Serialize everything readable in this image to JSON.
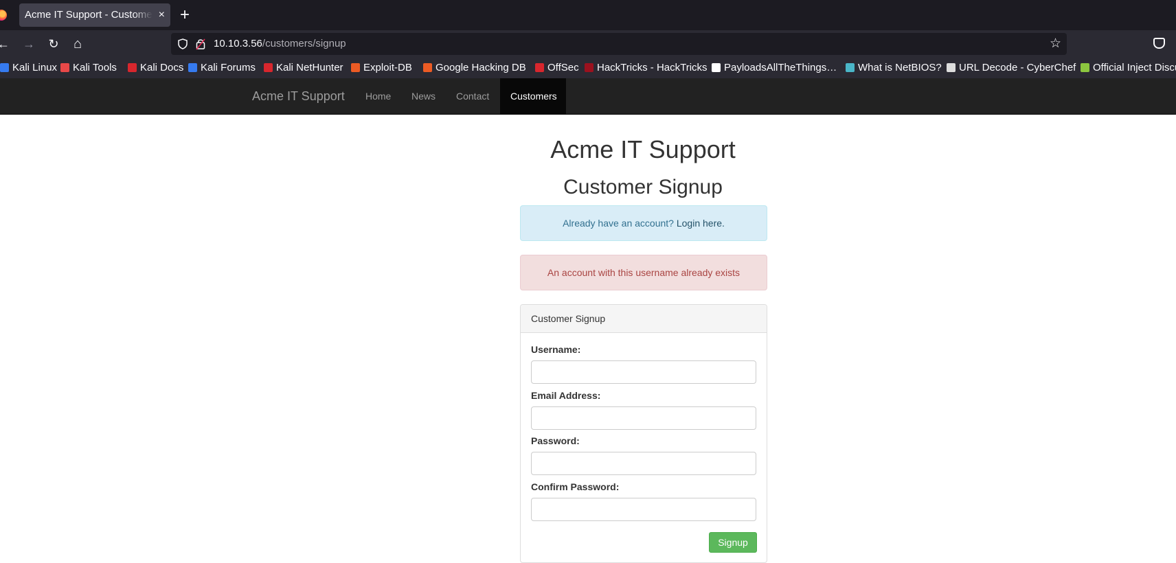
{
  "browser": {
    "tab_title": "Acme IT Support - Customers",
    "tab_close": "×",
    "new_tab": "+",
    "back": "←",
    "forward": "→",
    "reload": "↻",
    "home": "⌂",
    "url_host": "10.10.3.56",
    "url_path": "/customers/signup",
    "bookmark_star": "☆",
    "bookmarks": [
      {
        "label": "Kali Linux",
        "color": "#367bf0"
      },
      {
        "label": "Kali Tools",
        "color": "#e84848"
      },
      {
        "label": "Kali Docs",
        "color": "#d8262d"
      },
      {
        "label": "Kali Forums",
        "color": "#367bf0"
      },
      {
        "label": "Kali NetHunter",
        "color": "#d8262d"
      },
      {
        "label": "Exploit-DB",
        "color": "#ec5b24"
      },
      {
        "label": "Google Hacking DB",
        "color": "#ec5b24"
      },
      {
        "label": "OffSec",
        "color": "#d8262d"
      },
      {
        "label": "HackTricks - HackTricks",
        "color": "#9b111e"
      },
      {
        "label": "PayloadsAllTheThings…",
        "color": "#ffffff"
      },
      {
        "label": "What is NetBIOS?",
        "color": "#4ab6c8"
      },
      {
        "label": "URL Decode - CyberChef",
        "color": "#dddddd"
      },
      {
        "label": "Official Inject Discu",
        "color": "#8cc63f"
      }
    ]
  },
  "site": {
    "brand": "Acme IT Support",
    "nav": [
      {
        "label": "Home",
        "active": false
      },
      {
        "label": "News",
        "active": false
      },
      {
        "label": "Contact",
        "active": false
      },
      {
        "label": "Customers",
        "active": true
      }
    ],
    "page_title": "Acme IT Support",
    "page_subtitle": "Customer Signup",
    "info_alert": {
      "text": "Already have an account? ",
      "link": "Login here."
    },
    "error_alert": "An account with this username already exists",
    "form": {
      "heading": "Customer Signup",
      "username_label": "Username:",
      "email_label": "Email Address:",
      "password_label": "Password:",
      "confirm_label": "Confirm Password:",
      "username_value": "",
      "email_value": "",
      "password_value": "",
      "confirm_value": "",
      "submit_label": "Signup"
    }
  }
}
